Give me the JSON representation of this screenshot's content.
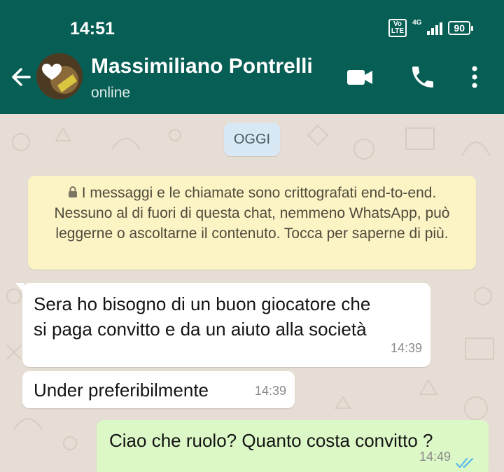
{
  "status_bar": {
    "time": "14:51",
    "volte_label": "Vo LTE",
    "network": "4G",
    "battery": "90"
  },
  "header": {
    "contact_name": "Massimiliano Pontrelli",
    "contact_status": "online",
    "icons": [
      "back-arrow-icon",
      "video-call-icon",
      "phone-call-icon",
      "more-options-icon"
    ],
    "color": "#075e54"
  },
  "chat": {
    "date_label": "OGGI",
    "encryption_notice": "I messaggi e le chiamate sono crittografati end-to-end. Nessuno al di fuori di questa chat, nemmeno WhatsApp, può leggerne o ascoltarne il contenuto. Tocca per saperne di più.",
    "messages": [
      {
        "direction": "incoming",
        "line1": "Sera ho bisogno di un buon giocatore che",
        "line2": "si paga convitto e da un aiuto alla società",
        "time": "14:39"
      },
      {
        "direction": "incoming",
        "text": "Under preferibilmente",
        "time": "14:39"
      },
      {
        "direction": "outgoing",
        "text": "Ciao che ruolo? Quanto costa convitto ?",
        "time": "14:49",
        "status": "read"
      }
    ],
    "colors": {
      "incoming": "#ffffff",
      "outgoing": "#dcf8c6",
      "read_ticks": "#4fb6ec"
    }
  }
}
